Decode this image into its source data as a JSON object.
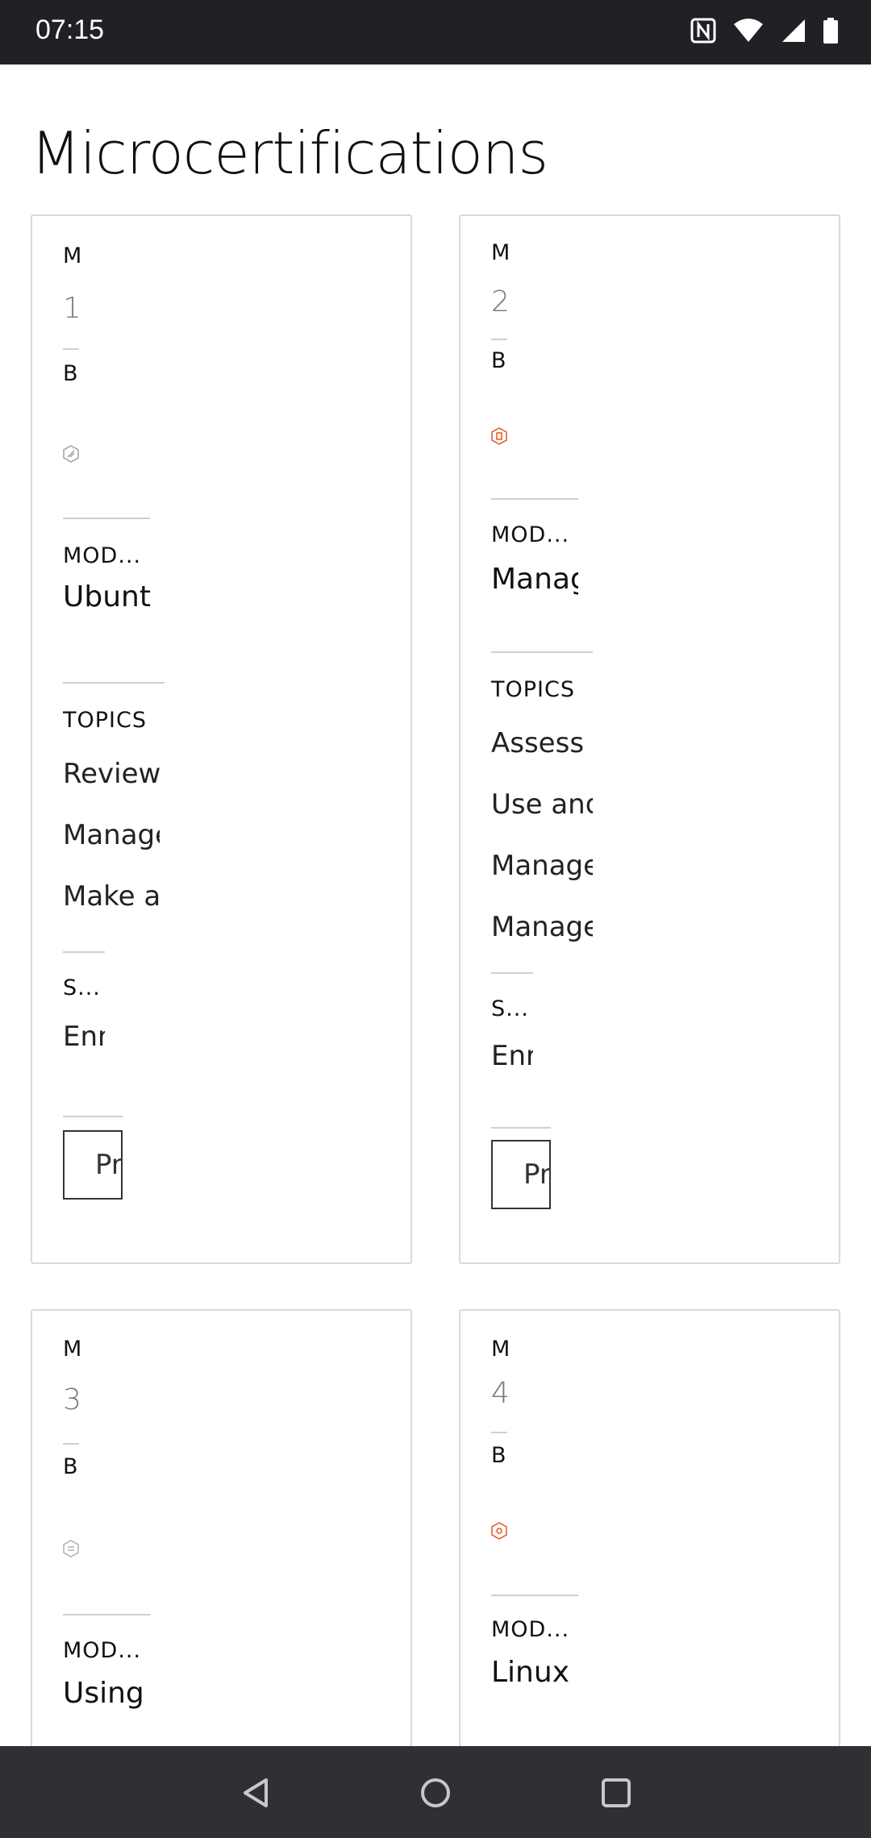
{
  "status_bar": {
    "time": "07:15"
  },
  "page": {
    "title": "Microcertifications"
  },
  "cards": [
    {
      "eyebrow": "M",
      "number": "1",
      "badge_label": "B",
      "module_label": "MOD...",
      "module_name": "Ubunt",
      "topics_label": "TOPICS",
      "topics": [
        "Review",
        "Manage",
        "Make ac"
      ],
      "status_label": "S...",
      "status_value": "Enr",
      "button_label": "Pr"
    },
    {
      "eyebrow": "M",
      "number": "2",
      "badge_label": "B",
      "module_label": "MOD...",
      "module_name": "Manag",
      "topics_label": "TOPICS",
      "topics": [
        "Assess p",
        "Use and",
        "Manage",
        "Manage"
      ],
      "status_label": "S...",
      "status_value": "Enr",
      "button_label": "Pr"
    },
    {
      "eyebrow": "M",
      "number": "3",
      "badge_label": "B",
      "module_label": "MOD...",
      "module_name": "Using"
    },
    {
      "eyebrow": "M",
      "number": "4",
      "badge_label": "B",
      "module_label": "MOD...",
      "module_name": "Linux I"
    }
  ],
  "icons": {
    "nfc": "nfc-icon",
    "wifi": "wifi-icon",
    "signal": "signal-icon",
    "battery": "battery-icon",
    "back": "back-icon",
    "home": "home-icon",
    "recents": "recents-icon"
  },
  "colors": {
    "status_bar": "#202124",
    "nav_bar": "#2f3034",
    "card_border": "#d9d9d9",
    "badge_1": "#9aa0a6",
    "badge_2": "#e95420",
    "badge_3": "#b0b0b0",
    "badge_4": "#e95420"
  }
}
